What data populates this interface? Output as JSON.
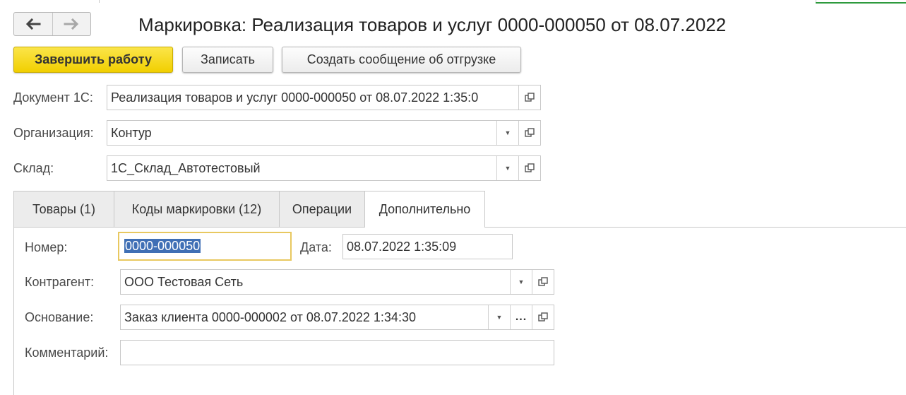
{
  "nav": {
    "back_icon": "arrow-left-icon",
    "forward_icon": "arrow-right-icon"
  },
  "title": "Маркировка: Реализация товаров и услуг 0000-000050 от 08.07.2022",
  "toolbar": {
    "finish_label": "Завершить работу",
    "save_label": "Записать",
    "create_message_label": "Создать сообщение об отгрузке"
  },
  "header_fields": {
    "document": {
      "label": "Документ 1С:",
      "value": "Реализация товаров и услуг 0000-000050 от 08.07.2022 1:35:0"
    },
    "organization": {
      "label": "Организация:",
      "value": "Контур"
    },
    "warehouse": {
      "label": "Склад:",
      "value": "1С_Склад_Автотестовый"
    }
  },
  "tabs": [
    {
      "label": "Товары (1)",
      "active": false
    },
    {
      "label": "Коды маркировки (12)",
      "active": false
    },
    {
      "label": "Операции",
      "active": false
    },
    {
      "label": "Дополнительно",
      "active": true
    }
  ],
  "additional": {
    "number": {
      "label": "Номер:",
      "value": "0000-000050"
    },
    "date": {
      "label": "Дата:",
      "value": "08.07.2022  1:35:09"
    },
    "counterparty": {
      "label": "Контрагент:",
      "value": "ООО Тестовая Сеть"
    },
    "basis": {
      "label": "Основание:",
      "value": "Заказ клиента 0000-000002 от 08.07.2022 1:34:30"
    },
    "comment": {
      "label": "Комментарий:",
      "value": ""
    }
  },
  "colors": {
    "primary_button": "#f4d81c",
    "selection": "#3f6fb5",
    "focus_border": "#e8c860",
    "accent_green": "#2e9a3e"
  }
}
